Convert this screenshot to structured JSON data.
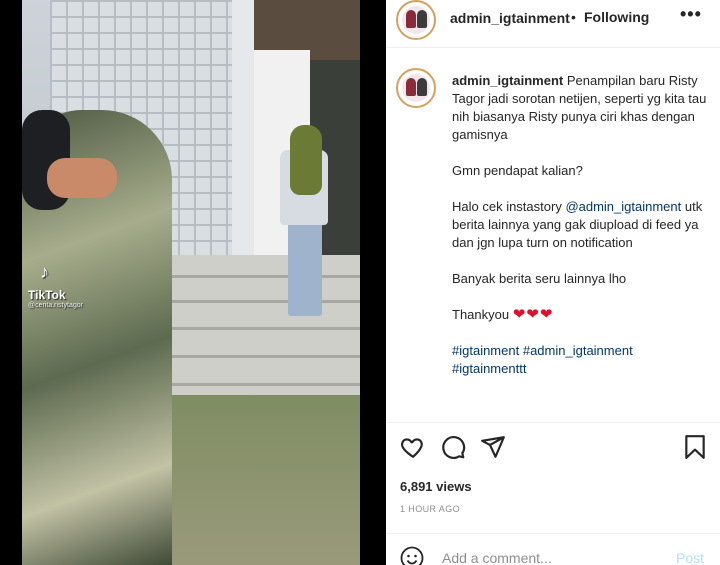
{
  "video": {
    "watermark_logo": "♪",
    "watermark_brand": "TikTok",
    "watermark_user": "@cerita.ristytagor"
  },
  "header": {
    "username": "admin_igtainment",
    "separator": "•",
    "follow_label": "Following",
    "more_label": "•••"
  },
  "caption": {
    "username": "admin_igtainment",
    "line1": "Penampilan baru Risty Tagor jadi sorotan netijen, seperti yg kita tau nih biasanya Risty punya ciri khas dengan gamisnya",
    "line2": "Gmn pendapat kalian?",
    "line3_pre": "Halo cek instastory ",
    "line3_mention": "@admin_igtainment",
    "line3_post": " utk berita lainnya yang gak diupload di feed ya dan jgn lupa turn on notification",
    "line4": "Banyak berita seru lainnya lho",
    "line5": "Thankyou",
    "hearts": "❤❤❤",
    "hashtag1": "#igtainment",
    "hashtag2": "#admin_igtainment",
    "hashtag3": "#igtainmenttt"
  },
  "actions": {
    "icons": [
      "heart-icon",
      "comment-icon",
      "share-icon",
      "bookmark-icon"
    ]
  },
  "stats": {
    "views": "6,891 views",
    "time": "1 HOUR AGO"
  },
  "comment": {
    "placeholder": "Add a comment...",
    "post_label": "Post"
  },
  "colors": {
    "link": "#00376b",
    "heart": "#e0102c",
    "post_disabled": "#b2dffc",
    "muted": "#8e8e8e"
  }
}
